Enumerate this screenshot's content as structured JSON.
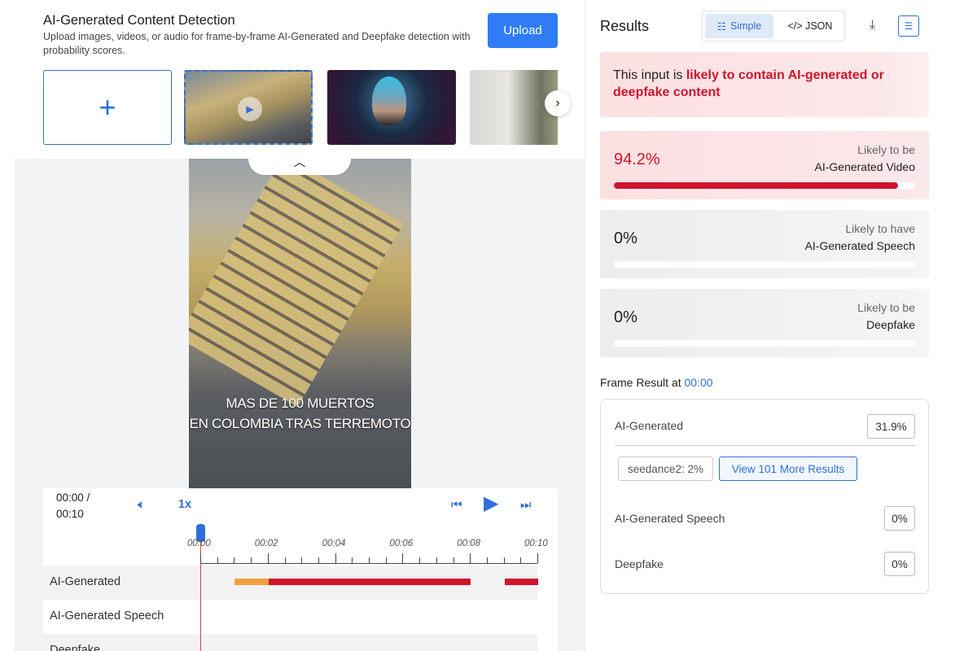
{
  "header": {
    "title": "AI-Generated Content Detection",
    "description": "Upload images, videos, or audio for frame-by-frame AI-Generated and Deepfake detection with probability scores.",
    "upload_label": "Upload"
  },
  "thumbnails": {
    "add_icon": "plus-icon",
    "next_icon": "chevron-right-icon"
  },
  "video": {
    "caption_line1": "MAS DE 100 MUERTOS",
    "caption_line2": "EN COLOMBIA TRAS TERREMOTO",
    "collapse_icon": "chevron-up-icon"
  },
  "controls": {
    "time_current": "00:00 /",
    "time_total": "00:10",
    "speed": "1x",
    "volume_icon": "volume-icon",
    "prev_icon": "skip-back-icon",
    "play_icon": "play-icon",
    "next_icon": "skip-forward-icon"
  },
  "timeline": {
    "labels": [
      "00:00",
      "00:02",
      "00:04",
      "00:06",
      "00:08",
      "00:10"
    ],
    "rows": [
      "AI-Generated",
      "AI-Generated Speech",
      "Deepfake"
    ],
    "duration_s": 10,
    "segments": [
      {
        "start": 1.0,
        "end": 2.0,
        "color": "#f0a040"
      },
      {
        "start": 2.0,
        "end": 8.0,
        "color": "#d0142c"
      },
      {
        "start": 9.0,
        "end": 10.0,
        "color": "#d0142c"
      }
    ],
    "playhead": 0
  },
  "results": {
    "title": "Results",
    "simple_label": "Simple",
    "json_label": "</> JSON",
    "download_icon": "download-icon",
    "list_icon": "list-view-icon",
    "verdict_prefix": "This input is ",
    "verdict_highlight": "likely to contain AI-generated or deepfake content",
    "cards": [
      {
        "pct": "94.2%",
        "value": 0.942,
        "line1": "Likely to be",
        "line2": "AI-Generated Video"
      },
      {
        "pct": "0%",
        "value": 0,
        "line1": "Likely to have",
        "line2": "AI-Generated Speech"
      },
      {
        "pct": "0%",
        "value": 0,
        "line1": "Likely to be",
        "line2": "Deepfake"
      }
    ]
  },
  "frame": {
    "title": "Frame Result at ",
    "time": "00:00",
    "ai_label": "AI-Generated",
    "ai_value": "31.9%",
    "chip_model": "seedance2: 2%",
    "chip_more": "View 101 More Results",
    "speech_label": "AI-Generated Speech",
    "speech_value": "0%",
    "deepfake_label": "Deepfake",
    "deepfake_value": "0%"
  },
  "colors": {
    "accent": "#2f7cf6",
    "alert": "#d0142c"
  }
}
